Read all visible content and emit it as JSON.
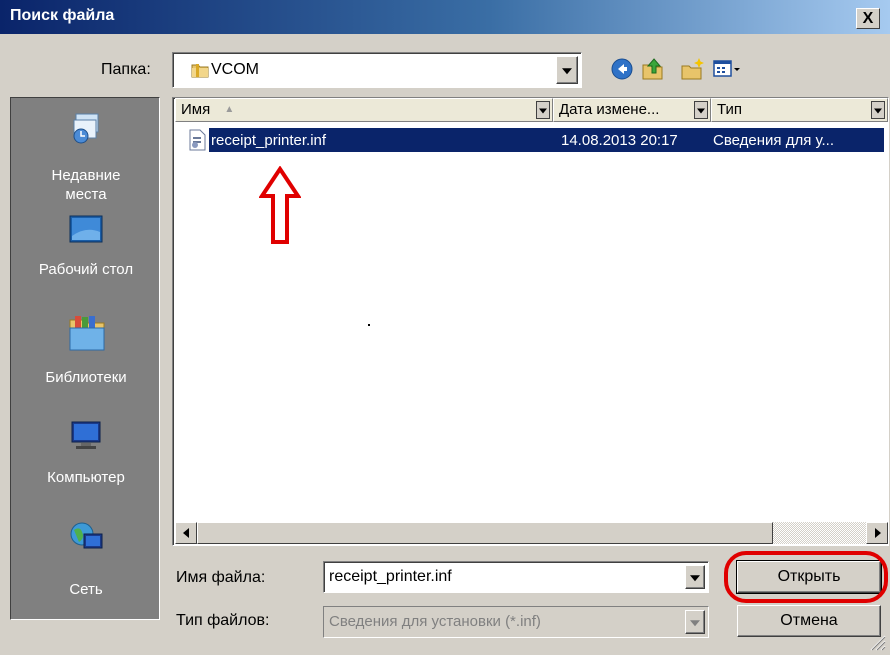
{
  "window": {
    "title": "Поиск файла",
    "close_glyph": "X"
  },
  "folder": {
    "label": "Папка:",
    "current": "VCOM",
    "icon": "folder-icon"
  },
  "toolbar": {
    "buttons": [
      {
        "name": "back",
        "icon": "back-arrow-icon"
      },
      {
        "name": "up",
        "icon": "folder-up-icon"
      },
      {
        "name": "new-folder",
        "icon": "new-folder-icon"
      },
      {
        "name": "view-menu",
        "icon": "view-menu-icon"
      }
    ]
  },
  "places": [
    {
      "label": "Недавние\nместа",
      "icon": "recent-places-icon"
    },
    {
      "label": "Рабочий стол",
      "icon": "desktop-icon"
    },
    {
      "label": "Библиотеки",
      "icon": "libraries-icon"
    },
    {
      "label": "Компьютер",
      "icon": "computer-icon"
    },
    {
      "label": "Сеть",
      "icon": "network-icon"
    }
  ],
  "columns": [
    {
      "label": "Имя",
      "sort": "ascending"
    },
    {
      "label": "Дата измене..."
    },
    {
      "label": "Тип"
    }
  ],
  "files": [
    {
      "name": "receipt_printer.inf",
      "date": "14.08.2013 20:17",
      "type": "Сведения для у...",
      "selected": true
    }
  ],
  "annotation_arrow": {
    "color": "#e00000"
  },
  "filename": {
    "label": "Имя файла:",
    "value": "receipt_printer.inf"
  },
  "filetype": {
    "label": "Тип файлов:",
    "value": "Сведения для установки (*.inf)"
  },
  "buttons": {
    "open": "Открыть",
    "cancel": "Отмена"
  },
  "colors": {
    "selection": "#0a246a",
    "dialog_bg": "#d4d0c8",
    "annotation": "#e00000"
  }
}
